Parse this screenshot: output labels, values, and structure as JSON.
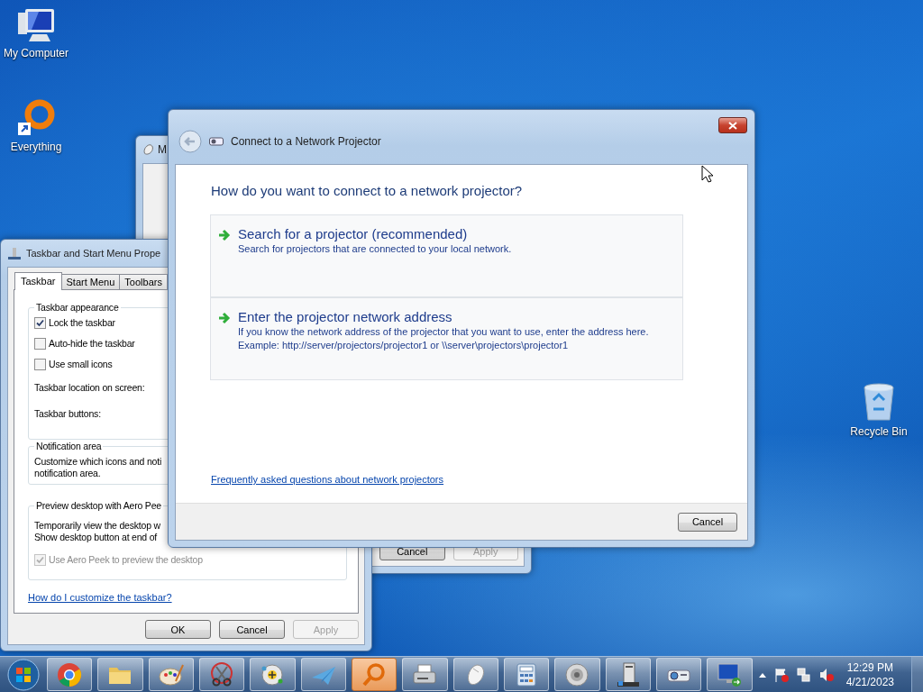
{
  "desktop_icons": [
    {
      "label": "My Computer",
      "kind": "computer"
    },
    {
      "label": "Everything",
      "kind": "everything"
    },
    {
      "label": "Recycle Bin",
      "kind": "recycle"
    }
  ],
  "back_window": {
    "title": "M",
    "buttons": [
      {
        "label": "Cancel",
        "disabled": false
      },
      {
        "label": "Apply",
        "disabled": true
      }
    ]
  },
  "taskbar_properties": {
    "title": "Taskbar and Start Menu Prope",
    "tabs": [
      {
        "label": "Taskbar",
        "selected": true
      },
      {
        "label": "Start Menu",
        "selected": false
      },
      {
        "label": "Toolbars",
        "selected": false
      }
    ],
    "groups": [
      {
        "title": "Taskbar appearance",
        "items": [
          {
            "kind": "checkbox",
            "label": "Lock the taskbar",
            "checked": true,
            "disabled": false
          },
          {
            "kind": "checkbox",
            "label": "Auto-hide the taskbar",
            "checked": false,
            "disabled": false
          },
          {
            "kind": "checkbox",
            "label": "Use small icons",
            "checked": false,
            "disabled": false
          },
          {
            "kind": "label",
            "label": "Taskbar location on screen:"
          },
          {
            "kind": "label",
            "label": "Taskbar buttons:"
          }
        ]
      },
      {
        "title": "Notification area",
        "items": [
          {
            "kind": "text",
            "label": "Customize which icons and noti"
          },
          {
            "kind": "text",
            "label": "notification area."
          }
        ]
      },
      {
        "title": "Preview desktop with Aero Pee",
        "items": [
          {
            "kind": "text",
            "label": "Temporarily view the desktop w"
          },
          {
            "kind": "text",
            "label": "Show desktop button at end of"
          },
          {
            "kind": "checkbox",
            "label": "Use Aero Peek to preview the desktop",
            "checked": true,
            "disabled": true
          }
        ]
      }
    ],
    "link": "How do I customize the taskbar?",
    "buttons": [
      {
        "label": "OK",
        "disabled": false
      },
      {
        "label": "Cancel",
        "disabled": false
      },
      {
        "label": "Apply",
        "disabled": true
      }
    ]
  },
  "dialog": {
    "title": "Connect to a Network Projector",
    "heading": "How do you want to connect to a network projector?",
    "options": [
      {
        "title": "Search for a projector (recommended)",
        "lines": [
          "Search for projectors that are connected to your local network."
        ]
      },
      {
        "title": "Enter the projector network address",
        "lines": [
          "If you know the network address of the projector that you want to use, enter the address here.",
          "Example: http://server/projectors/projector1 or \\\\server\\projectors\\projector1"
        ]
      }
    ],
    "link": "Frequently asked questions about network projectors",
    "buttons": [
      {
        "label": "Cancel"
      }
    ]
  },
  "taskbar": {
    "apps": [
      {
        "kind": "chrome",
        "active": false
      },
      {
        "kind": "folder",
        "active": false
      },
      {
        "kind": "paint",
        "active": false
      },
      {
        "kind": "scissors",
        "active": false
      },
      {
        "kind": "ball",
        "active": false
      },
      {
        "kind": "plane",
        "active": false
      },
      {
        "kind": "search",
        "active": true
      },
      {
        "kind": "printer",
        "active": false
      },
      {
        "kind": "mouse",
        "active": false
      },
      {
        "kind": "calculator",
        "active": false
      },
      {
        "kind": "speaker",
        "active": false
      },
      {
        "kind": "tower",
        "active": false
      },
      {
        "kind": "projector",
        "active": false
      },
      {
        "kind": "monitor",
        "active": false
      }
    ],
    "clock": {
      "time": "12:29 PM",
      "date": "4/21/2023"
    }
  }
}
